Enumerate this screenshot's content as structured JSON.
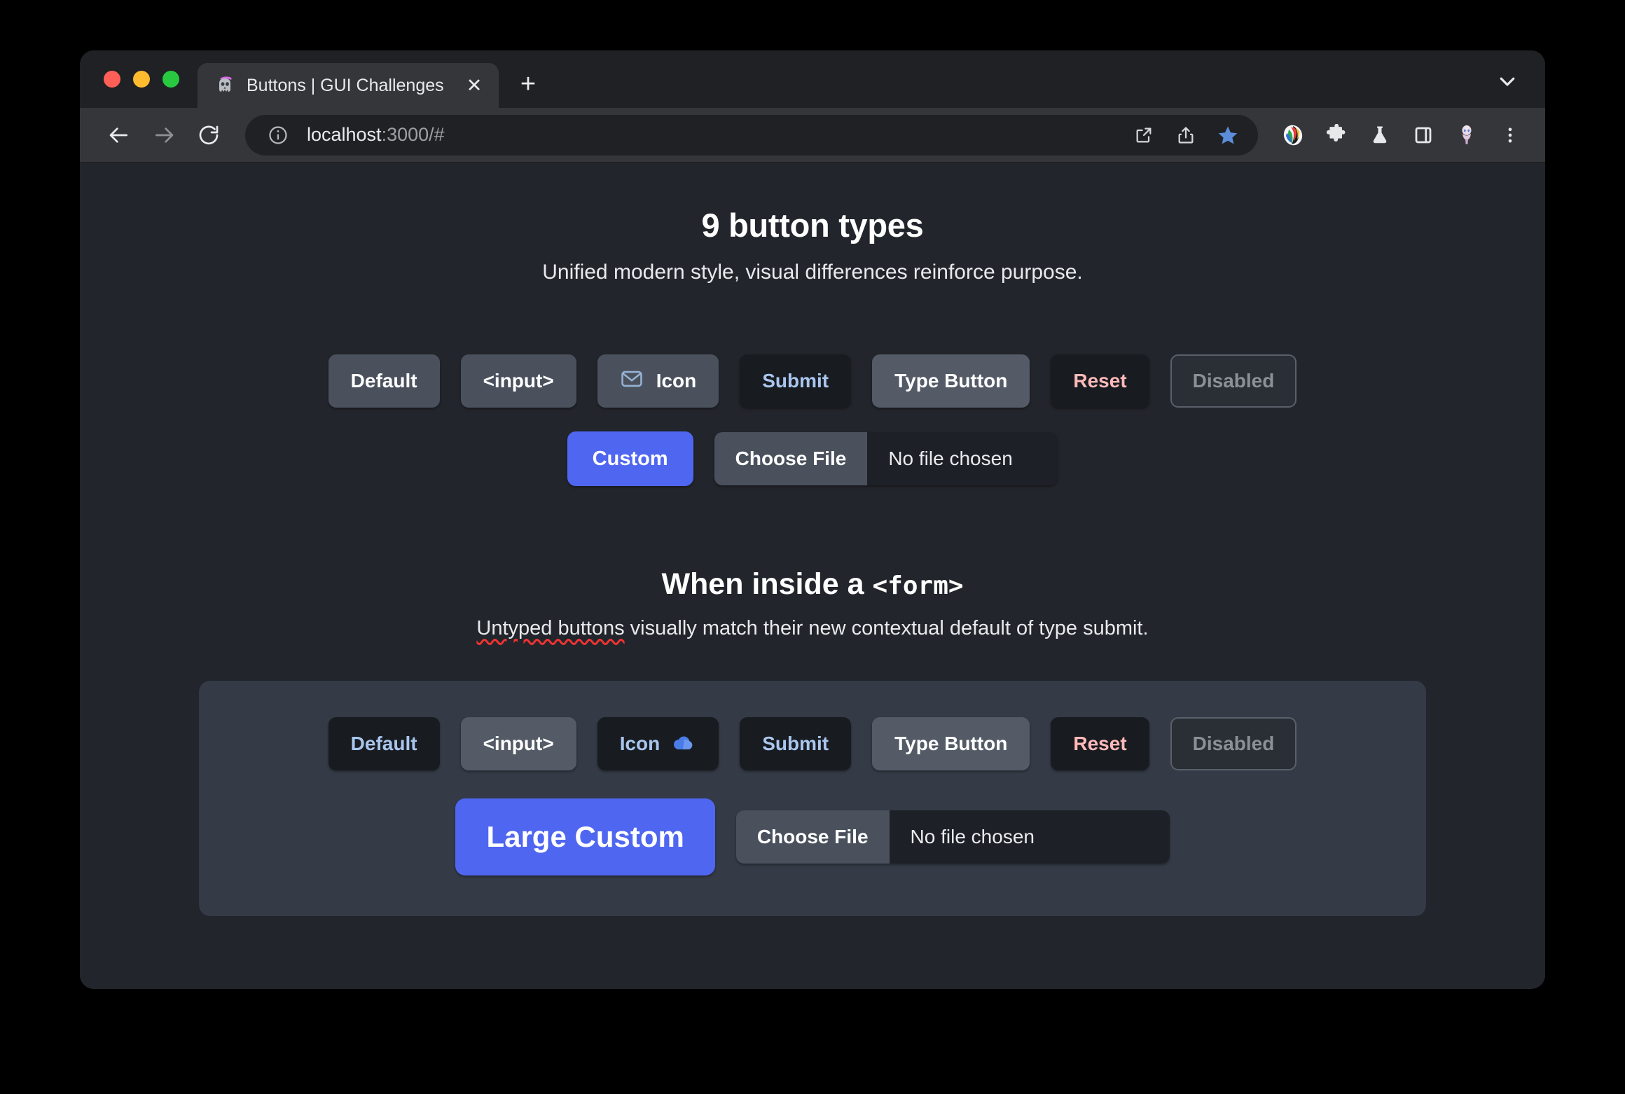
{
  "browser": {
    "tab": {
      "title": "Buttons | GUI Challenges",
      "favicon_name": "ghost-skull-favicon",
      "close_label": "✕"
    },
    "new_tab_label": "+",
    "omnibox": {
      "url_host": "localhost",
      "url_path": ":3000/#",
      "info_icon": "info-circle-icon"
    },
    "toolbar_icons": [
      "back-arrow-icon",
      "forward-arrow-icon",
      "reload-icon",
      "open-in-new-icon",
      "share-icon",
      "bookmark-star-icon",
      "color-palette-extension-icon",
      "puzzle-extension-icon",
      "flask-labs-icon",
      "side-panel-icon",
      "profile-avatar-icon",
      "three-dot-menu-icon"
    ],
    "colors": {
      "tab_active_bg": "#35363a",
      "tabstrip_bg": "#202124",
      "toolbar_bg": "#35363a",
      "omnibox_bg": "#202124",
      "star_blue": "#5b8dd9"
    }
  },
  "page": {
    "background": "#22252b",
    "title": "9 button types",
    "subtitle": "Unified modern style, visual differences reinforce purpose.",
    "row1": [
      {
        "label": "Default",
        "style": "neutral"
      },
      {
        "label": "<input>",
        "style": "neutral"
      },
      {
        "label": "Icon",
        "style": "icon-btn",
        "icon": "envelope-icon",
        "icon_side": "left"
      },
      {
        "label": "Submit",
        "style": "dark-submit"
      },
      {
        "label": "Type Button",
        "style": "neutral-lite"
      },
      {
        "label": "Reset",
        "style": "dark-reset"
      },
      {
        "label": "Disabled",
        "style": "disabled"
      }
    ],
    "row2": {
      "custom_label": "Custom",
      "file_button_label": "Choose File",
      "file_status_label": "No file chosen"
    }
  },
  "form_section": {
    "title_text": "When inside a ",
    "title_mono": "<form>",
    "subtitle_spellchecked": "Untyped buttons",
    "subtitle_rest": " visually match their new contextual default of type submit.",
    "panel_background": "#343a46",
    "row1": [
      {
        "label": "Default",
        "style": "default-form"
      },
      {
        "label": "<input>",
        "style": "neutral"
      },
      {
        "label": "Icon",
        "style": "icon-btn-form",
        "icon": "cloud-icon",
        "icon_side": "right"
      },
      {
        "label": "Submit",
        "style": "dark-submit"
      },
      {
        "label": "Type Button",
        "style": "neutral-lite"
      },
      {
        "label": "Reset",
        "style": "dark-reset"
      },
      {
        "label": "Disabled",
        "style": "disabled"
      }
    ],
    "row2": {
      "custom_label": "Large Custom",
      "file_button_label": "Choose File",
      "file_status_label": "No file chosen"
    }
  },
  "colors": {
    "accent_blue": "#4f66f0",
    "submit_text": "#a9c6ee",
    "reset_text": "#ffb9b9",
    "neutral_bg": "#4a515d",
    "neutral_lite_bg": "#545b67",
    "dark_bg": "#181b20",
    "disabled_text": "#8b9097"
  }
}
